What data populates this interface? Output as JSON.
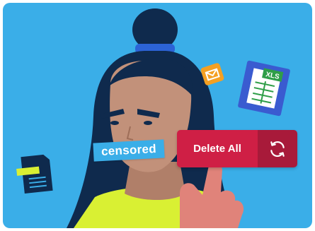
{
  "censor_label": "censored",
  "button": {
    "label": "Delete All",
    "icon": "refresh-icon"
  },
  "file_icon": {
    "label": "XLS",
    "icon": "xls-file-icon"
  },
  "email_icon": {
    "icon": "envelope-icon"
  },
  "doc_icon": {
    "icon": "document-icon"
  },
  "colors": {
    "background": "#3aaee8",
    "hair": "#0f2a4d",
    "skin": "#c2917a",
    "shirt": "#d9f033",
    "hand": "#e0837a",
    "button": "#cf1f45",
    "button_dark": "#a81a3a",
    "xls_card": "#3a5bd0",
    "xls_green": "#2f9e48",
    "email_orange": "#f4a023"
  }
}
